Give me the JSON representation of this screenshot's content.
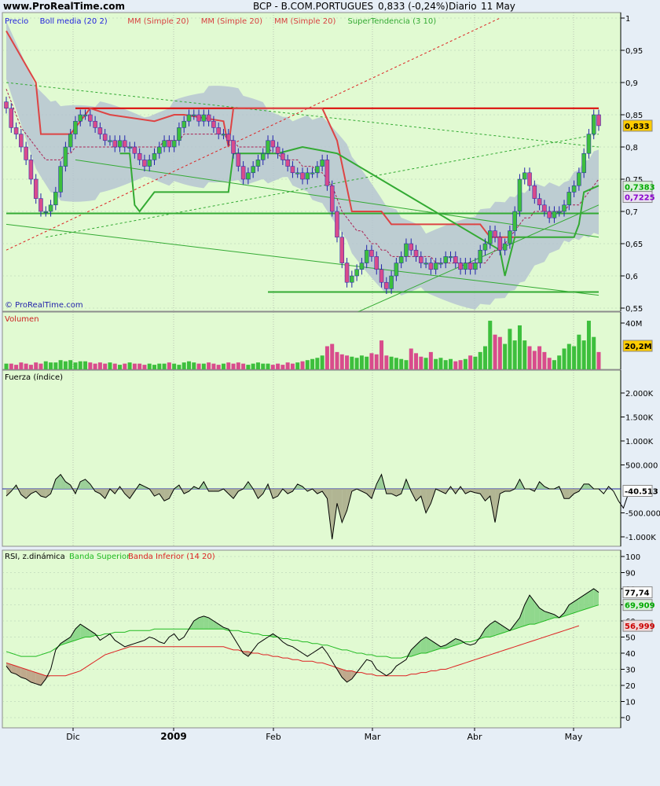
{
  "header": {
    "site": "www.ProRealTime.com",
    "ticker": "BCP - B.COM.PORTUGUES",
    "quote": "0,833 (-0,24%)",
    "period": "Diario",
    "date": "11 May"
  },
  "watermark": "© ProRealTime.com",
  "colors": {
    "panel_bg": "#E1FAD2",
    "frame": "#8C8C8C",
    "page_bg": "#E6EEF6",
    "up": "#3DBF3D",
    "down": "#D84C8C",
    "boll": "#B4C2D2",
    "price_axis": "#0000CC"
  },
  "chart_data": [
    {
      "type": "candlestick",
      "panel": "price",
      "legend": [
        {
          "label": "Precio",
          "color": "#2222DD"
        },
        {
          "label": "Boll media (20 2)",
          "color": "#2222DD"
        },
        {
          "label": "MM (Simple 20)",
          "color": "#D84040"
        },
        {
          "label": "MM (Simple 20)",
          "color": "#D84040"
        },
        {
          "label": "MM (Simple 20)",
          "color": "#D84040"
        },
        {
          "label": "SuperTendencia (3 10)",
          "color": "#33AA33"
        }
      ],
      "x_ticks": [
        "Dic",
        "2009",
        "Feb",
        "Mar",
        "Abr",
        "May"
      ],
      "y_ticks": [
        "1",
        "0,95",
        "0,9",
        "0,85",
        "0,8",
        "0,75",
        "0,7",
        "0,65",
        "0,6",
        "0,55"
      ],
      "ylim": [
        0.54,
        1.01
      ],
      "close": [
        0.86,
        0.83,
        0.82,
        0.8,
        0.78,
        0.75,
        0.72,
        0.7,
        0.7,
        0.71,
        0.73,
        0.77,
        0.8,
        0.82,
        0.84,
        0.85,
        0.85,
        0.84,
        0.83,
        0.82,
        0.81,
        0.81,
        0.8,
        0.81,
        0.8,
        0.8,
        0.79,
        0.78,
        0.77,
        0.78,
        0.79,
        0.8,
        0.81,
        0.8,
        0.81,
        0.83,
        0.84,
        0.85,
        0.85,
        0.84,
        0.85,
        0.84,
        0.83,
        0.82,
        0.82,
        0.81,
        0.79,
        0.77,
        0.75,
        0.76,
        0.77,
        0.78,
        0.79,
        0.81,
        0.8,
        0.79,
        0.78,
        0.77,
        0.76,
        0.76,
        0.75,
        0.76,
        0.76,
        0.77,
        0.78,
        0.74,
        0.7,
        0.66,
        0.62,
        0.59,
        0.6,
        0.61,
        0.62,
        0.64,
        0.63,
        0.61,
        0.59,
        0.58,
        0.6,
        0.62,
        0.63,
        0.65,
        0.64,
        0.63,
        0.62,
        0.62,
        0.61,
        0.62,
        0.62,
        0.63,
        0.63,
        0.62,
        0.61,
        0.62,
        0.61,
        0.62,
        0.64,
        0.65,
        0.67,
        0.66,
        0.64,
        0.65,
        0.67,
        0.7,
        0.75,
        0.76,
        0.74,
        0.72,
        0.71,
        0.7,
        0.69,
        0.7,
        0.7,
        0.71,
        0.73,
        0.74,
        0.76,
        0.79,
        0.82,
        0.85,
        0.833
      ],
      "boll_middle": [
        0.95,
        0.93,
        0.91,
        0.89,
        0.87,
        0.85,
        0.83,
        0.82,
        0.81,
        0.8,
        0.8,
        0.79,
        0.79,
        0.79,
        0.79,
        0.79,
        0.79,
        0.79,
        0.79,
        0.8,
        0.8,
        0.8,
        0.8,
        0.8,
        0.8,
        0.8,
        0.8,
        0.8,
        0.8,
        0.8,
        0.8,
        0.8,
        0.8,
        0.8,
        0.81,
        0.81,
        0.81,
        0.81,
        0.81,
        0.81,
        0.81,
        0.82,
        0.82,
        0.82,
        0.82,
        0.82,
        0.82,
        0.82,
        0.81,
        0.81,
        0.81,
        0.81,
        0.81,
        0.8,
        0.8,
        0.8,
        0.8,
        0.8,
        0.79,
        0.79,
        0.79,
        0.79,
        0.78,
        0.78,
        0.78,
        0.77,
        0.76,
        0.75,
        0.74,
        0.73,
        0.71,
        0.7,
        0.69,
        0.68,
        0.67,
        0.66,
        0.65,
        0.64,
        0.64,
        0.64,
        0.63,
        0.63,
        0.63,
        0.63,
        0.63,
        0.62,
        0.62,
        0.62,
        0.62,
        0.62,
        0.62,
        0.62,
        0.62,
        0.62,
        0.62,
        0.62,
        0.63,
        0.63,
        0.63,
        0.64,
        0.64,
        0.64,
        0.65,
        0.65,
        0.66,
        0.66,
        0.67,
        0.68,
        0.68,
        0.68,
        0.69,
        0.69,
        0.69,
        0.7,
        0.7,
        0.71,
        0.71,
        0.72,
        0.72,
        0.73,
        0.73
      ],
      "supertrend": [
        {
          "x": 0,
          "y": null
        },
        {
          "x": 23,
          "y": 0.79
        },
        {
          "x": 25,
          "y": 0.79
        },
        {
          "x": 26,
          "y": 0.71
        },
        {
          "x": 27,
          "y": 0.7
        },
        {
          "x": 30,
          "y": 0.73
        },
        {
          "x": 40,
          "y": 0.73
        },
        {
          "x": 45,
          "y": 0.73
        },
        {
          "x": 46,
          "y": 0.79
        },
        {
          "x": 55,
          "y": 0.79
        },
        {
          "x": 60,
          "y": 0.8
        },
        {
          "x": 67,
          "y": 0.79
        },
        {
          "x": 100,
          "y": 0.64
        },
        {
          "x": 101,
          "y": 0.6
        },
        {
          "x": 103,
          "y": 0.66
        },
        {
          "x": 111,
          "y": 0.66
        },
        {
          "x": 115,
          "y": 0.66
        },
        {
          "x": 116,
          "y": 0.68
        },
        {
          "x": 117,
          "y": 0.73
        },
        {
          "x": 120,
          "y": 0.74
        }
      ],
      "ma_red": [
        {
          "x": 0,
          "y": 0.98
        },
        {
          "x": 6,
          "y": 0.9
        },
        {
          "x": 7,
          "y": 0.82
        },
        {
          "x": 13,
          "y": 0.82
        },
        {
          "x": 17,
          "y": 0.86
        },
        {
          "x": 21,
          "y": 0.85
        },
        {
          "x": 30,
          "y": 0.84
        },
        {
          "x": 34,
          "y": 0.85
        },
        {
          "x": 36,
          "y": 0.85
        },
        {
          "x": 44,
          "y": 0.84
        },
        {
          "x": 45,
          "y": 0.8
        },
        {
          "x": 46,
          "y": 0.86
        },
        {
          "x": 64,
          "y": 0.86
        },
        {
          "x": 67,
          "y": 0.81
        },
        {
          "x": 70,
          "y": 0.7
        },
        {
          "x": 76,
          "y": 0.7
        },
        {
          "x": 78,
          "y": 0.68
        },
        {
          "x": 96,
          "y": 0.68
        },
        {
          "x": 98,
          "y": 0.66
        },
        {
          "x": 104,
          "y": 0.66
        }
      ],
      "ma_dashed": [
        0.89,
        0.87,
        0.85,
        0.83,
        0.82,
        0.81,
        0.8,
        0.79,
        0.78,
        0.78,
        0.78,
        0.78,
        0.79,
        0.79,
        0.8,
        0.8,
        0.8,
        0.8,
        0.8,
        0.8,
        0.8,
        0.8,
        0.8,
        0.8,
        0.8,
        0.8,
        0.8,
        0.8,
        0.8,
        0.8,
        0.8,
        0.8,
        0.81,
        0.81,
        0.81,
        0.81,
        0.82,
        0.82,
        0.82,
        0.82,
        0.82,
        0.82,
        0.82,
        0.82,
        0.82,
        0.81,
        0.81,
        0.8,
        0.8,
        0.8,
        0.8,
        0.8,
        0.8,
        0.8,
        0.79,
        0.79,
        0.78,
        0.78,
        0.78,
        0.78,
        0.77,
        0.77,
        0.77,
        0.76,
        0.76,
        0.75,
        0.74,
        0.72,
        0.7,
        0.69,
        0.68,
        0.67,
        0.67,
        0.66,
        0.65,
        0.65,
        0.64,
        0.64,
        0.63,
        0.63,
        0.63,
        0.63,
        0.63,
        0.63,
        0.63,
        0.63,
        0.63,
        0.62,
        0.62,
        0.62,
        0.62,
        0.62,
        0.62,
        0.62,
        0.62,
        0.62,
        0.62,
        0.62,
        0.63,
        0.64,
        0.64,
        0.65,
        0.66,
        0.67,
        0.68,
        0.69,
        0.69,
        0.7,
        0.7,
        0.7,
        0.7,
        0.7,
        0.7,
        0.7,
        0.71,
        0.71,
        0.71,
        0.72,
        0.73,
        0.74,
        0.75
      ],
      "trendlines": [
        {
          "from": [
            0,
            0.68
          ],
          "to": [
            120,
            0.57
          ],
          "color": "#33AA33"
        },
        {
          "from": [
            0,
            0.9
          ],
          "to": [
            120,
            0.8
          ],
          "color": "#33AA33",
          "dash": true
        },
        {
          "from": [
            8,
            0.66
          ],
          "to": [
            120,
            0.82
          ],
          "color": "#33AA33",
          "dash": true
        },
        {
          "from": [
            14,
            0.78
          ],
          "to": [
            120,
            0.66
          ],
          "color": "#33AA33"
        },
        {
          "from": [
            70,
            0.54
          ],
          "to": [
            120,
            0.71
          ],
          "color": "#33AA33"
        },
        {
          "from": [
            0,
            0.64
          ],
          "to": [
            100,
            1.0
          ],
          "color": "#DD2222",
          "dash": true
        }
      ],
      "hlines": [
        {
          "y": 0.86,
          "from": 14,
          "to": 120,
          "color": "#DD0000"
        },
        {
          "y": 0.697,
          "from": 0,
          "to": 120,
          "color": "#33AA33"
        },
        {
          "y": 0.575,
          "from": 53,
          "to": 120,
          "color": "#33AA33"
        }
      ],
      "tags": [
        {
          "value": 0.833,
          "text": "0,833",
          "bg": "#FFCC00",
          "color": "#000000"
        },
        {
          "value": 0.7383,
          "text": "0,7383",
          "bg": "#D8F0D8",
          "color": "#00AA00"
        },
        {
          "value": 0.7225,
          "text": "0,7225",
          "bg": "#E8E0F0",
          "color": "#8800CC"
        }
      ]
    },
    {
      "type": "bar",
      "panel": "volume",
      "title": "Volumen",
      "y_ticks": [
        "40M"
      ],
      "values": [
        5,
        5,
        4,
        6,
        5,
        4,
        6,
        5,
        7,
        6,
        6,
        8,
        7,
        8,
        6,
        7,
        7,
        6,
        5,
        6,
        5,
        6,
        5,
        4,
        5,
        6,
        5,
        5,
        4,
        5,
        4,
        5,
        5,
        6,
        5,
        4,
        6,
        7,
        6,
        5,
        5,
        6,
        5,
        4,
        5,
        6,
        5,
        6,
        5,
        4,
        5,
        6,
        5,
        5,
        4,
        5,
        4,
        6,
        5,
        6,
        7,
        8,
        9,
        10,
        12,
        20,
        22,
        15,
        13,
        12,
        11,
        10,
        12,
        11,
        14,
        13,
        25,
        12,
        11,
        10,
        9,
        8,
        18,
        14,
        11,
        10,
        15,
        9,
        10,
        8,
        9,
        7,
        8,
        9,
        12,
        11,
        15,
        20,
        42,
        30,
        28,
        22,
        35,
        25,
        38,
        25,
        20,
        16,
        20,
        15,
        10,
        8,
        12,
        18,
        22,
        20,
        30,
        25,
        42,
        28,
        15
      ],
      "ylim": [
        0,
        45
      ],
      "tag": {
        "text": "20,2M",
        "bg": "#FFCC00"
      }
    },
    {
      "type": "area",
      "panel": "fuerza",
      "title": "Fuerza (índice)",
      "y_ticks": [
        "2.000K",
        "1.500K",
        "1.000K",
        "500.000",
        "-500.000",
        "-1.000K"
      ],
      "values": [
        -150,
        -50,
        80,
        -120,
        -200,
        -100,
        -50,
        -150,
        -180,
        -100,
        200,
        300,
        150,
        80,
        -100,
        150,
        200,
        100,
        -50,
        -100,
        -200,
        0,
        -100,
        50,
        -100,
        -200,
        -50,
        100,
        50,
        0,
        -150,
        -100,
        -250,
        -200,
        0,
        80,
        -100,
        -50,
        50,
        0,
        150,
        -50,
        -50,
        -50,
        0,
        -100,
        -200,
        -50,
        0,
        150,
        0,
        -200,
        -100,
        100,
        -200,
        -150,
        0,
        -100,
        -50,
        100,
        50,
        -50,
        0,
        -100,
        -50,
        -200,
        -1050,
        -300,
        -700,
        -450,
        -50,
        0,
        -50,
        -100,
        -200,
        100,
        300,
        -100,
        -100,
        -150,
        -100,
        200,
        -50,
        -250,
        -150,
        -500,
        -300,
        0,
        -50,
        -100,
        50,
        -100,
        50,
        -100,
        -50,
        -80,
        -100,
        -250,
        -150,
        -700,
        -100,
        -50,
        -50,
        0,
        200,
        0,
        0,
        -50,
        150,
        50,
        0,
        0,
        50,
        -200,
        -200,
        -100,
        -50,
        100,
        100,
        0,
        0,
        -100,
        50,
        -50,
        -250,
        -400,
        -100,
        50,
        -50
      ],
      "tag": {
        "text": "-40.513",
        "bg": "#FFFFFF"
      }
    },
    {
      "type": "line",
      "panel": "rsi",
      "title": "RSI, z.dinámica",
      "legend": [
        {
          "label": "Banda Superior",
          "color": "#22BB22"
        },
        {
          "label": "Banda Inferior (14 20)",
          "color": "#DD2222"
        }
      ],
      "y_ticks": [
        "100",
        "90",
        "80",
        "70",
        "60",
        "50",
        "40",
        "30",
        "20",
        "10",
        "0"
      ],
      "ylim": [
        -5,
        103
      ],
      "rsi": [
        32,
        28,
        27,
        25,
        24,
        22,
        21,
        20,
        24,
        30,
        42,
        46,
        48,
        50,
        55,
        58,
        56,
        54,
        52,
        48,
        50,
        52,
        48,
        46,
        44,
        45,
        46,
        47,
        48,
        50,
        49,
        47,
        46,
        50,
        52,
        48,
        50,
        55,
        60,
        62,
        63,
        62,
        60,
        58,
        56,
        55,
        50,
        45,
        40,
        38,
        42,
        46,
        48,
        50,
        52,
        50,
        47,
        45,
        44,
        42,
        40,
        38,
        40,
        42,
        44,
        40,
        35,
        30,
        25,
        22,
        24,
        28,
        32,
        36,
        35,
        30,
        28,
        26,
        28,
        32,
        34,
        36,
        42,
        45,
        48,
        50,
        48,
        46,
        44,
        45,
        47,
        49,
        48,
        46,
        45,
        46,
        50,
        55,
        58,
        60,
        58,
        56,
        54,
        58,
        62,
        70,
        76,
        72,
        68,
        66,
        65,
        64,
        62,
        65,
        70,
        72,
        74,
        76,
        78,
        80,
        77.74
      ],
      "band_superior": [
        41,
        40,
        39,
        38,
        38,
        38,
        38,
        39,
        40,
        41,
        43,
        45,
        46,
        47,
        48,
        49,
        50,
        50,
        51,
        51,
        52,
        52,
        53,
        53,
        53,
        54,
        54,
        54,
        54,
        54,
        55,
        55,
        55,
        55,
        55,
        55,
        55,
        55,
        55,
        55,
        55,
        55,
        55,
        55,
        55,
        54,
        54,
        54,
        53,
        53,
        52,
        52,
        51,
        51,
        50,
        50,
        49,
        49,
        48,
        48,
        47,
        47,
        46,
        46,
        45,
        45,
        44,
        43,
        42,
        42,
        41,
        40,
        40,
        39,
        39,
        38,
        38,
        38,
        37,
        37,
        37,
        38,
        38,
        39,
        40,
        40,
        41,
        42,
        43,
        43,
        44,
        45,
        46,
        47,
        47,
        48,
        49,
        50,
        50,
        51,
        52,
        53,
        54,
        55,
        56,
        57,
        58,
        58,
        59,
        60,
        61,
        62,
        62,
        63,
        64,
        65,
        66,
        67,
        68,
        69,
        69.909
      ],
      "band_inferior": [
        34,
        33,
        32,
        31,
        30,
        29,
        28,
        27,
        26,
        26,
        26,
        26,
        26,
        27,
        28,
        29,
        31,
        33,
        35,
        37,
        39,
        40,
        41,
        42,
        43,
        44,
        44,
        44,
        44,
        44,
        44,
        44,
        44,
        44,
        44,
        44,
        44,
        44,
        44,
        44,
        44,
        44,
        44,
        44,
        44,
        43,
        42,
        42,
        41,
        41,
        40,
        40,
        39,
        39,
        38,
        38,
        37,
        37,
        36,
        36,
        35,
        35,
        35,
        34,
        34,
        33,
        32,
        31,
        30,
        29,
        29,
        28,
        28,
        27,
        27,
        26,
        26,
        26,
        26,
        26,
        26,
        26,
        27,
        27,
        28,
        28,
        29,
        29,
        30,
        30,
        31,
        32,
        33,
        34,
        35,
        36,
        37,
        38,
        39,
        40,
        41,
        42,
        43,
        44,
        45,
        46,
        47,
        48,
        49,
        50,
        51,
        52,
        53,
        54,
        55,
        56,
        56.999
      ],
      "tags": [
        {
          "text": "77,74",
          "bg": "#FFFFFF",
          "color": "#000000",
          "value": 77.74
        },
        {
          "text": "69,909",
          "bg": "#D8F0D8",
          "color": "#00AA00",
          "value": 69.909
        },
        {
          "text": "56,999",
          "bg": "#F0D8D8",
          "color": "#CC0000",
          "value": 56.999
        }
      ]
    }
  ]
}
